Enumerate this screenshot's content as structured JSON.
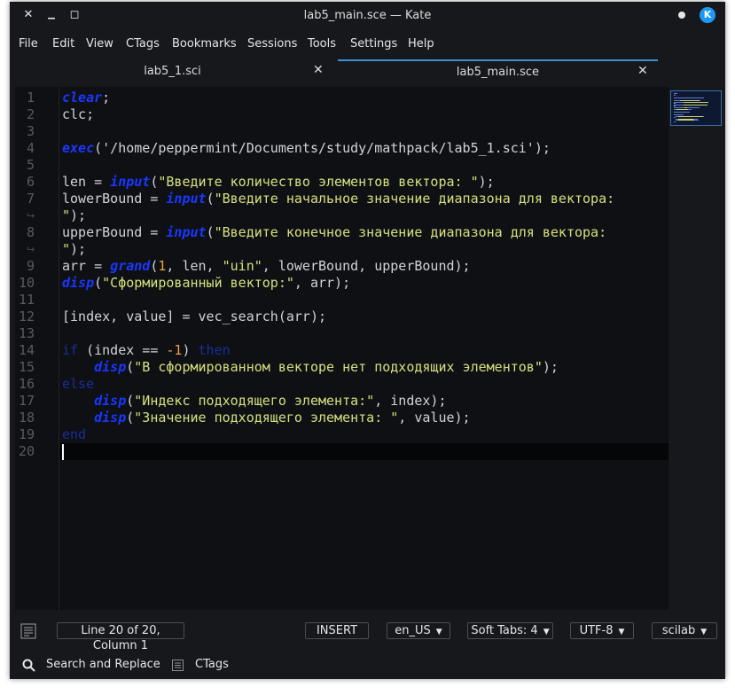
{
  "window": {
    "title": "lab5_main.sce — Kate",
    "close_glyph": "✕",
    "minimize_glyph": "▁",
    "maximize_glyph": "◻",
    "app_logo_glyph": "K"
  },
  "menu": [
    "File",
    "Edit",
    "View",
    "CTags",
    "Bookmarks",
    "Sessions",
    "Tools",
    "Settings",
    "Help"
  ],
  "tabs": [
    {
      "label": "lab5_1.sci",
      "active": false
    },
    {
      "label": "lab5_main.sce",
      "active": true
    }
  ],
  "tab_close_glyph": "✕",
  "editor": {
    "line_numbers": [
      "1",
      "2",
      "3",
      "4",
      "5",
      "6",
      "7",
      "8",
      "9",
      "10",
      "11",
      "12",
      "13",
      "14",
      "15",
      "16",
      "17",
      "18",
      "19",
      "20"
    ],
    "wrap_marker": "↪",
    "lines": [
      [
        {
          "t": "clear",
          "c": "kw"
        },
        {
          "t": ";",
          "c": "op"
        }
      ],
      [
        {
          "t": "clc;",
          "c": "op"
        }
      ],
      [],
      [
        {
          "t": "exec",
          "c": "kw"
        },
        {
          "t": "(",
          "c": "op"
        },
        {
          "t": "'/home/peppermint/Documents/study/mathpack/lab5_1.sci'",
          "c": "op"
        },
        {
          "t": ");",
          "c": "op"
        }
      ],
      [],
      [
        {
          "t": "len = ",
          "c": "op"
        },
        {
          "t": "input",
          "c": "kw"
        },
        {
          "t": "(",
          "c": "op"
        },
        {
          "t": "\"Введите количество элементов вектора: \"",
          "c": "str"
        },
        {
          "t": ");",
          "c": "op"
        }
      ],
      [
        {
          "t": "lowerBound = ",
          "c": "op"
        },
        {
          "t": "input",
          "c": "kw"
        },
        {
          "t": "(",
          "c": "op"
        },
        {
          "t": "\"Введите начальное значение диапазона для вектора:",
          "c": "str"
        }
      ],
      [
        {
          "t": "\"",
          "c": "str"
        },
        {
          "t": ");",
          "c": "op"
        }
      ],
      [
        {
          "t": "upperBound = ",
          "c": "op"
        },
        {
          "t": "input",
          "c": "kw"
        },
        {
          "t": "(",
          "c": "op"
        },
        {
          "t": "\"Введите конечное значение диапазона для вектора:",
          "c": "str"
        }
      ],
      [
        {
          "t": "\"",
          "c": "str"
        },
        {
          "t": ");",
          "c": "op"
        }
      ],
      [
        {
          "t": "arr = ",
          "c": "op"
        },
        {
          "t": "grand",
          "c": "kw"
        },
        {
          "t": "(",
          "c": "op"
        },
        {
          "t": "1",
          "c": "num"
        },
        {
          "t": ", len, ",
          "c": "op"
        },
        {
          "t": "\"uin\"",
          "c": "str"
        },
        {
          "t": ", lowerBound, upperBound);",
          "c": "op"
        }
      ],
      [
        {
          "t": "disp",
          "c": "kw"
        },
        {
          "t": "(",
          "c": "op"
        },
        {
          "t": "\"Сформированный вектор:\"",
          "c": "str"
        },
        {
          "t": ", arr);",
          "c": "op"
        }
      ],
      [],
      [
        {
          "t": "[index, value] = vec_search(arr);",
          "c": "op"
        }
      ],
      [],
      [
        {
          "t": "if",
          "c": "ctl"
        },
        {
          "t": " (index == ",
          "c": "op"
        },
        {
          "t": "-1",
          "c": "num"
        },
        {
          "t": ") ",
          "c": "op"
        },
        {
          "t": "then",
          "c": "ctl"
        }
      ],
      [
        {
          "t": "    ",
          "c": "op"
        },
        {
          "t": "disp",
          "c": "kw"
        },
        {
          "t": "(",
          "c": "op"
        },
        {
          "t": "\"В сформированном векторе нет подходящих элементов\"",
          "c": "str"
        },
        {
          "t": ");",
          "c": "op"
        }
      ],
      [
        {
          "t": "else",
          "c": "ctl"
        }
      ],
      [
        {
          "t": "    ",
          "c": "op"
        },
        {
          "t": "disp",
          "c": "kw"
        },
        {
          "t": "(",
          "c": "op"
        },
        {
          "t": "\"Индекс подходящего элемента:\"",
          "c": "str"
        },
        {
          "t": ", index);",
          "c": "op"
        }
      ],
      [
        {
          "t": "    ",
          "c": "op"
        },
        {
          "t": "disp",
          "c": "kw"
        },
        {
          "t": "(",
          "c": "op"
        },
        {
          "t": "\"Значение подходящего элемента: \"",
          "c": "str"
        },
        {
          "t": ", value);",
          "c": "op"
        }
      ],
      [
        {
          "t": "end",
          "c": "ctl"
        }
      ],
      []
    ]
  },
  "colors": {
    "background": "#0e1014",
    "keyword": "#1a37ff",
    "control": "#1b2e9c",
    "string": "#d7e07e",
    "number": "#f0a040",
    "accent": "#3b90d4"
  },
  "statusbar": {
    "position": "Line 20 of 20, Column 1",
    "mode": "INSERT",
    "dictionary": "en_US",
    "indent": "Soft Tabs: 4",
    "encoding": "UTF-8",
    "syntax": "scilab",
    "dropdown_glyph": "▼"
  },
  "bottombar": {
    "search_label": "Search and Replace",
    "ctags_label": "CTags"
  }
}
